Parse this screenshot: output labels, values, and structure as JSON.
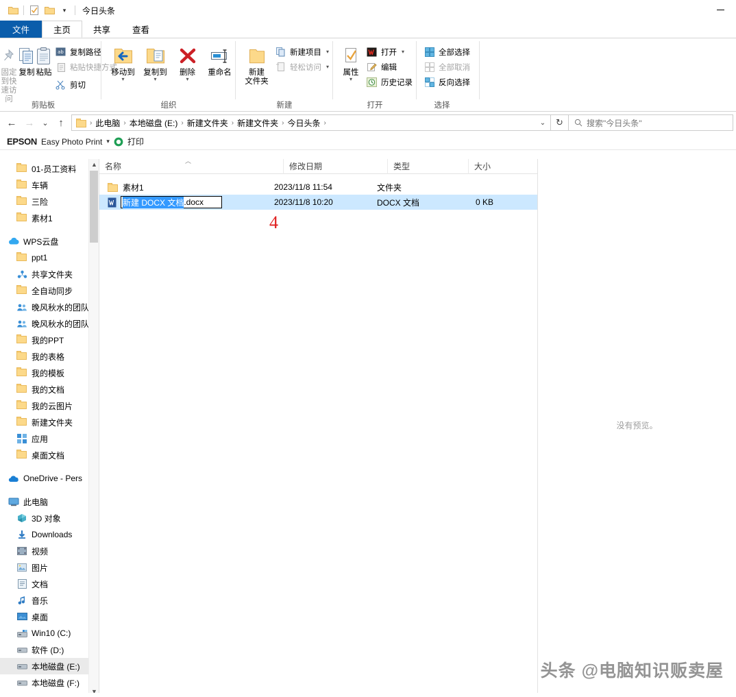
{
  "window": {
    "title": "今日头条",
    "minimize_label": "最小化"
  },
  "quick_access": {
    "items": [
      {
        "name": "folder-icon",
        "label": ""
      },
      {
        "name": "properties-check-icon",
        "label": ""
      },
      {
        "name": "new-folder-icon",
        "label": ""
      }
    ]
  },
  "tabs": [
    {
      "id": "file",
      "label": "文件"
    },
    {
      "id": "home",
      "label": "主页"
    },
    {
      "id": "share",
      "label": "共享"
    },
    {
      "id": "view",
      "label": "查看"
    }
  ],
  "ribbon": {
    "groups": [
      {
        "id": "clipboard",
        "label": "剪贴板",
        "big": [
          {
            "label": "固定到快\n速访问",
            "label_l1": "固定到快",
            "label_l2": "速访问",
            "icon": "pin-icon",
            "dim": true
          },
          {
            "label": "复制",
            "icon": "copy-icon",
            "dim": false
          },
          {
            "label": "粘贴",
            "icon": "paste-icon",
            "dim": false
          }
        ],
        "small": [
          {
            "label": "复制路径",
            "icon": "copy-path-icon"
          },
          {
            "label": "粘贴快捷方式",
            "icon": "paste-shortcut-icon",
            "dim": true
          },
          {
            "label": "剪切",
            "icon": "scissors-icon"
          }
        ]
      },
      {
        "id": "organize",
        "label": "组织",
        "big": [
          {
            "label": "移动到",
            "icon": "move-to-icon",
            "has_caret": true
          },
          {
            "label": "复制到",
            "icon": "copy-to-icon",
            "has_caret": true
          },
          {
            "label": "删除",
            "icon": "delete-icon",
            "has_caret": true
          },
          {
            "label": "重命名",
            "icon": "rename-icon"
          }
        ]
      },
      {
        "id": "new",
        "label": "新建",
        "big": [
          {
            "label_l1": "新建",
            "label_l2": "文件夹",
            "icon": "new-folder-icon"
          }
        ],
        "small": [
          {
            "label": "新建项目",
            "icon": "new-item-icon",
            "has_caret": true
          },
          {
            "label": "轻松访问",
            "icon": "easy-access-icon",
            "has_caret": true,
            "dim": true
          }
        ]
      },
      {
        "id": "open",
        "label": "打开",
        "big": [
          {
            "label": "属性",
            "icon": "properties-icon",
            "has_caret": true
          }
        ],
        "small": [
          {
            "label": "打开",
            "icon": "wps-open-icon",
            "has_caret": true
          },
          {
            "label": "编辑",
            "icon": "edit-icon"
          },
          {
            "label": "历史记录",
            "icon": "history-icon"
          }
        ]
      },
      {
        "id": "select",
        "label": "选择",
        "small": [
          {
            "label": "全部选择",
            "icon": "select-all-icon"
          },
          {
            "label": "全部取消",
            "icon": "select-none-icon",
            "dim": true
          },
          {
            "label": "反向选择",
            "icon": "invert-selection-icon"
          }
        ]
      }
    ]
  },
  "address_bar": {
    "back_label": "后退",
    "forward_label": "前进",
    "recent_label": "最近浏览的位置",
    "up_label": "上移到",
    "breadcrumbs": [
      "此电脑",
      "本地磁盘 (E:)",
      "新建文件夹",
      "新建文件夹",
      "今日头条"
    ],
    "refresh_label": "刷新",
    "search_placeholder": "搜索\"今日头条\""
  },
  "epson_bar": {
    "brand": "EPSON",
    "product": "Easy Photo Print",
    "print_label": "打印"
  },
  "sidebar": {
    "sections": [
      {
        "items": [
          {
            "label": "01-员工资料",
            "icon": "folder-icon",
            "indent": 24
          },
          {
            "label": "车辆",
            "icon": "folder-icon",
            "indent": 24
          },
          {
            "label": "三险",
            "icon": "folder-icon",
            "indent": 24
          },
          {
            "label": "素材1",
            "icon": "folder-icon",
            "indent": 24
          }
        ]
      },
      {
        "items": [
          {
            "label": "WPS云盘",
            "icon": "cloud-icon",
            "indent": 12
          },
          {
            "label": "ppt1",
            "icon": "folder-icon",
            "indent": 24
          },
          {
            "label": "共享文件夹",
            "icon": "shared-folder-icon",
            "indent": 24
          },
          {
            "label": "全自动同步",
            "icon": "folder-icon",
            "indent": 24
          },
          {
            "label": "晚风秋水的团队",
            "icon": "team-icon",
            "indent": 24
          },
          {
            "label": "晚风秋水的团队",
            "icon": "team-icon",
            "indent": 24
          },
          {
            "label": "我的PPT",
            "icon": "folder-icon",
            "indent": 24
          },
          {
            "label": "我的表格",
            "icon": "folder-icon",
            "indent": 24
          },
          {
            "label": "我的模板",
            "icon": "folder-icon",
            "indent": 24
          },
          {
            "label": "我的文档",
            "icon": "folder-icon",
            "indent": 24
          },
          {
            "label": "我的云图片",
            "icon": "folder-icon",
            "indent": 24
          },
          {
            "label": "新建文件夹",
            "icon": "folder-icon",
            "indent": 24
          },
          {
            "label": "应用",
            "icon": "apps-icon",
            "indent": 24
          },
          {
            "label": "桌面文档",
            "icon": "folder-icon",
            "indent": 24
          }
        ]
      },
      {
        "items": [
          {
            "label": "OneDrive - Pers",
            "icon": "onedrive-icon",
            "indent": 12
          }
        ]
      },
      {
        "items": [
          {
            "label": "此电脑",
            "icon": "this-pc-icon",
            "indent": 12
          },
          {
            "label": "3D 对象",
            "icon": "3d-objects-icon",
            "indent": 24
          },
          {
            "label": "Downloads",
            "icon": "downloads-icon",
            "indent": 24
          },
          {
            "label": "视频",
            "icon": "videos-icon",
            "indent": 24
          },
          {
            "label": "图片",
            "icon": "pictures-icon",
            "indent": 24
          },
          {
            "label": "文档",
            "icon": "documents-icon",
            "indent": 24
          },
          {
            "label": "音乐",
            "icon": "music-icon",
            "indent": 24
          },
          {
            "label": "桌面",
            "icon": "desktop-icon",
            "indent": 24
          },
          {
            "label": "Win10 (C:)",
            "icon": "system-drive-icon",
            "indent": 24
          },
          {
            "label": "软件 (D:)",
            "icon": "drive-icon",
            "indent": 24
          },
          {
            "label": "本地磁盘 (E:)",
            "icon": "drive-icon",
            "indent": 24,
            "selected": true
          },
          {
            "label": "本地磁盘 (F:)",
            "icon": "drive-icon",
            "indent": 24
          }
        ]
      }
    ]
  },
  "file_list": {
    "columns": [
      {
        "key": "name",
        "label": "名称"
      },
      {
        "key": "date",
        "label": "修改日期"
      },
      {
        "key": "type",
        "label": "类型"
      },
      {
        "key": "size",
        "label": "大小"
      }
    ],
    "sort": {
      "column": "名称",
      "direction": "ascending"
    },
    "rows": [
      {
        "name": "素材1",
        "date": "2023/11/8 11:54",
        "type": "文件夹",
        "size": "",
        "icon": "folder-icon",
        "selected": false,
        "editing": false
      },
      {
        "name": "新建 DOCX 文档.docx",
        "name_selected_part": "新建 DOCX 文档",
        "name_unselected_part": ".docx",
        "date": "2023/11/8 10:20",
        "type": "DOCX 文档",
        "size": "0 KB",
        "icon": "word-doc-icon",
        "selected": true,
        "editing": true
      }
    ]
  },
  "annotation": {
    "step_number": "4",
    "color": "#e02020"
  },
  "preview_pane": {
    "message": "没有预览。"
  },
  "watermark": {
    "text": "头条 @电脑知识贩卖屋"
  },
  "colors": {
    "file_tab_blue": "#0b5dab",
    "selection_blue": "#cce8ff",
    "rename_select_blue": "#3399ff",
    "folder_yellow": "#fcd98a",
    "annotation_red": "#e02020"
  }
}
